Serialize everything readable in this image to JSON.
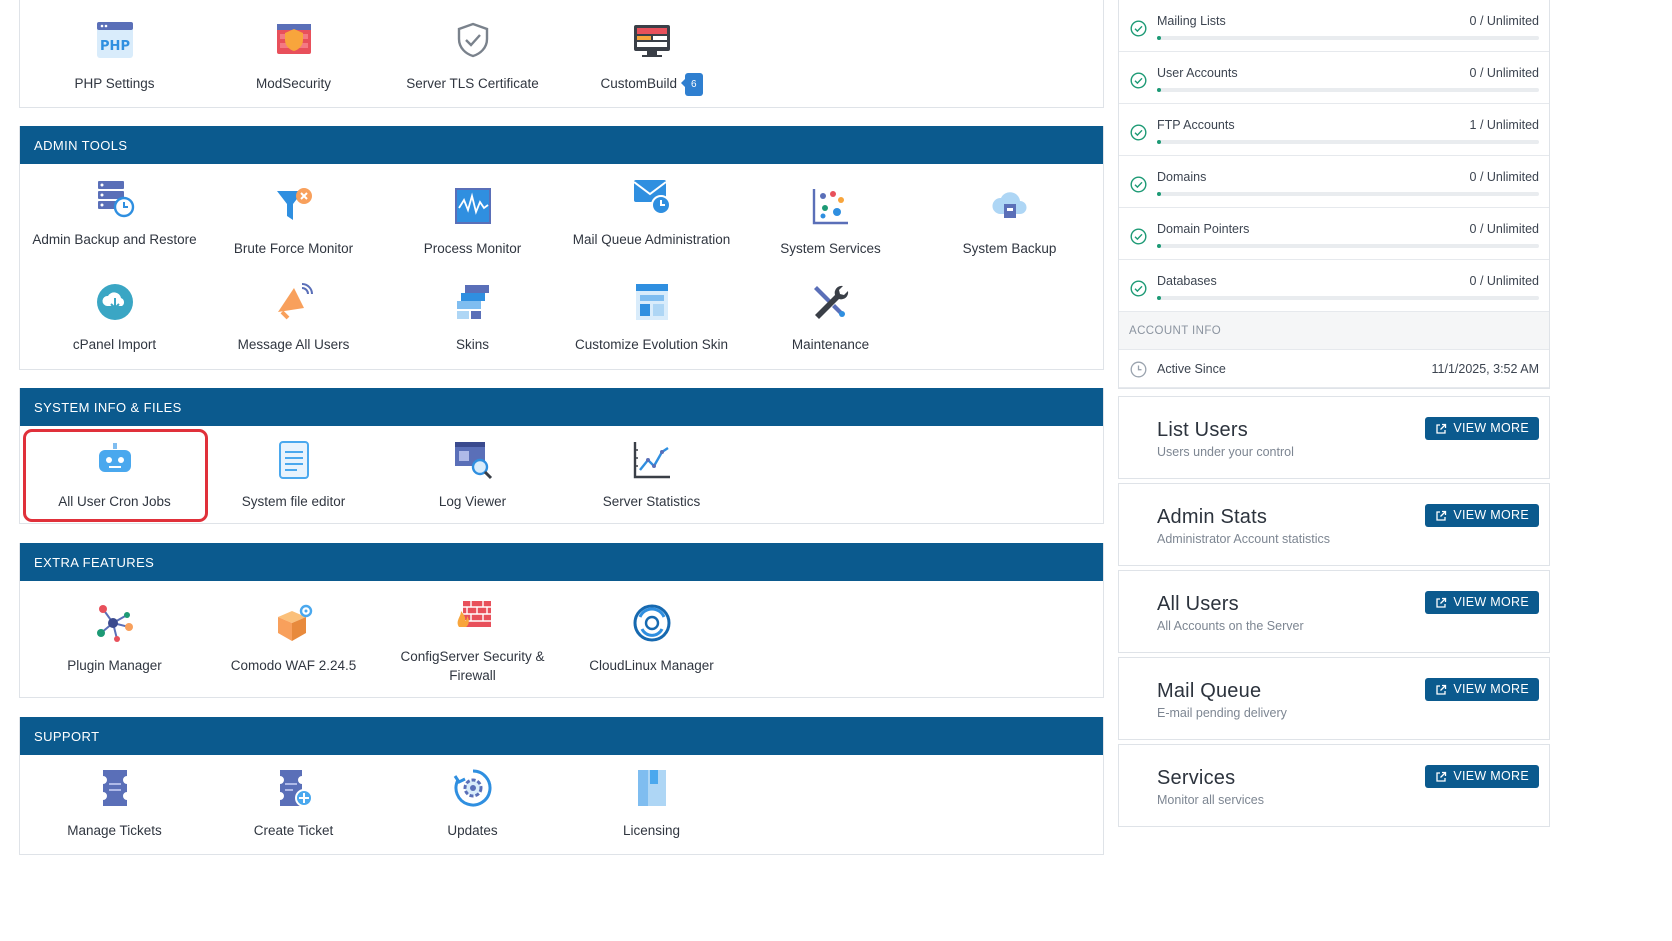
{
  "server_manager": {
    "tiles": [
      {
        "label": "PHP Settings",
        "icon": "php-icon"
      },
      {
        "label": "ModSecurity",
        "icon": "firewall-shield-icon"
      },
      {
        "label": "Server TLS Certificate",
        "icon": "shield-check-icon"
      },
      {
        "label": "CustomBuild",
        "icon": "monitor-icon",
        "badge": "6"
      }
    ]
  },
  "admin_tools": {
    "title": "ADMIN TOOLS",
    "tiles": [
      {
        "label": "Admin Backup and Restore",
        "icon": "database-clock-icon"
      },
      {
        "label": "Brute Force Monitor",
        "icon": "funnel-icon"
      },
      {
        "label": "Process Monitor",
        "icon": "pulse-monitor-icon"
      },
      {
        "label": "Mail Queue Administration",
        "icon": "mail-clock-icon"
      },
      {
        "label": "System Services",
        "icon": "scatter-chart-icon"
      },
      {
        "label": "System Backup",
        "icon": "cloud-backup-icon"
      },
      {
        "label": "cPanel Import",
        "icon": "cloud-download-icon"
      },
      {
        "label": "Message All Users",
        "icon": "megaphone-icon"
      },
      {
        "label": "Skins",
        "icon": "layers-icon"
      },
      {
        "label": "Customize Evolution Skin",
        "icon": "layout-icon"
      },
      {
        "label": "Maintenance",
        "icon": "tools-icon"
      }
    ]
  },
  "system_info": {
    "title": "SYSTEM INFO & FILES",
    "tiles": [
      {
        "label": "All User Cron Jobs",
        "icon": "robot-icon"
      },
      {
        "label": "System file editor",
        "icon": "document-icon"
      },
      {
        "label": "Log Viewer",
        "icon": "log-search-icon"
      },
      {
        "label": "Server Statistics",
        "icon": "line-chart-icon"
      }
    ]
  },
  "extra_features": {
    "title": "EXTRA FEATURES",
    "tiles": [
      {
        "label": "Plugin Manager",
        "icon": "network-nodes-icon"
      },
      {
        "label": "Comodo WAF 2.24.5",
        "icon": "box-gear-icon"
      },
      {
        "label": "ConfigServer Security & Firewall",
        "icon": "brick-firewall-icon"
      },
      {
        "label": "CloudLinux Manager",
        "icon": "cloudlinux-logo-icon"
      }
    ]
  },
  "support": {
    "title": "SUPPORT",
    "tiles": [
      {
        "label": "Manage Tickets",
        "icon": "ticket-icon"
      },
      {
        "label": "Create Ticket",
        "icon": "ticket-add-icon"
      },
      {
        "label": "Updates",
        "icon": "refresh-gear-icon"
      },
      {
        "label": "Licensing",
        "icon": "license-icon"
      }
    ]
  },
  "usage": [
    {
      "name": "Mailing Lists",
      "value": "0 / Unlimited",
      "fill": 0.01
    },
    {
      "name": "User Accounts",
      "value": "0 / Unlimited",
      "fill": 0.01
    },
    {
      "name": "FTP Accounts",
      "value": "1 / Unlimited",
      "fill": 0.01
    },
    {
      "name": "Domains",
      "value": "0 / Unlimited",
      "fill": 0.01
    },
    {
      "name": "Domain Pointers",
      "value": "0 / Unlimited",
      "fill": 0.01
    },
    {
      "name": "Databases",
      "value": "0 / Unlimited",
      "fill": 0.01
    }
  ],
  "account_info": {
    "title": "ACCOUNT INFO",
    "active_since_label": "Active Since",
    "active_since_value": "11/1/2025, 3:52 AM"
  },
  "cards": [
    {
      "title": "List Users",
      "subtitle": "Users under your control",
      "button": "VIEW MORE"
    },
    {
      "title": "Admin Stats",
      "subtitle": "Administrator Account statistics",
      "button": "VIEW MORE"
    },
    {
      "title": "All Users",
      "subtitle": "All Accounts on the Server",
      "button": "VIEW MORE"
    },
    {
      "title": "Mail Queue",
      "subtitle": "E-mail pending delivery",
      "button": "VIEW MORE"
    },
    {
      "title": "Services",
      "subtitle": "Monitor all services",
      "button": "VIEW MORE"
    }
  ],
  "colors": {
    "header": "#0b5a8e",
    "accent": "#1d9a75",
    "highlight": "#e0303a"
  }
}
